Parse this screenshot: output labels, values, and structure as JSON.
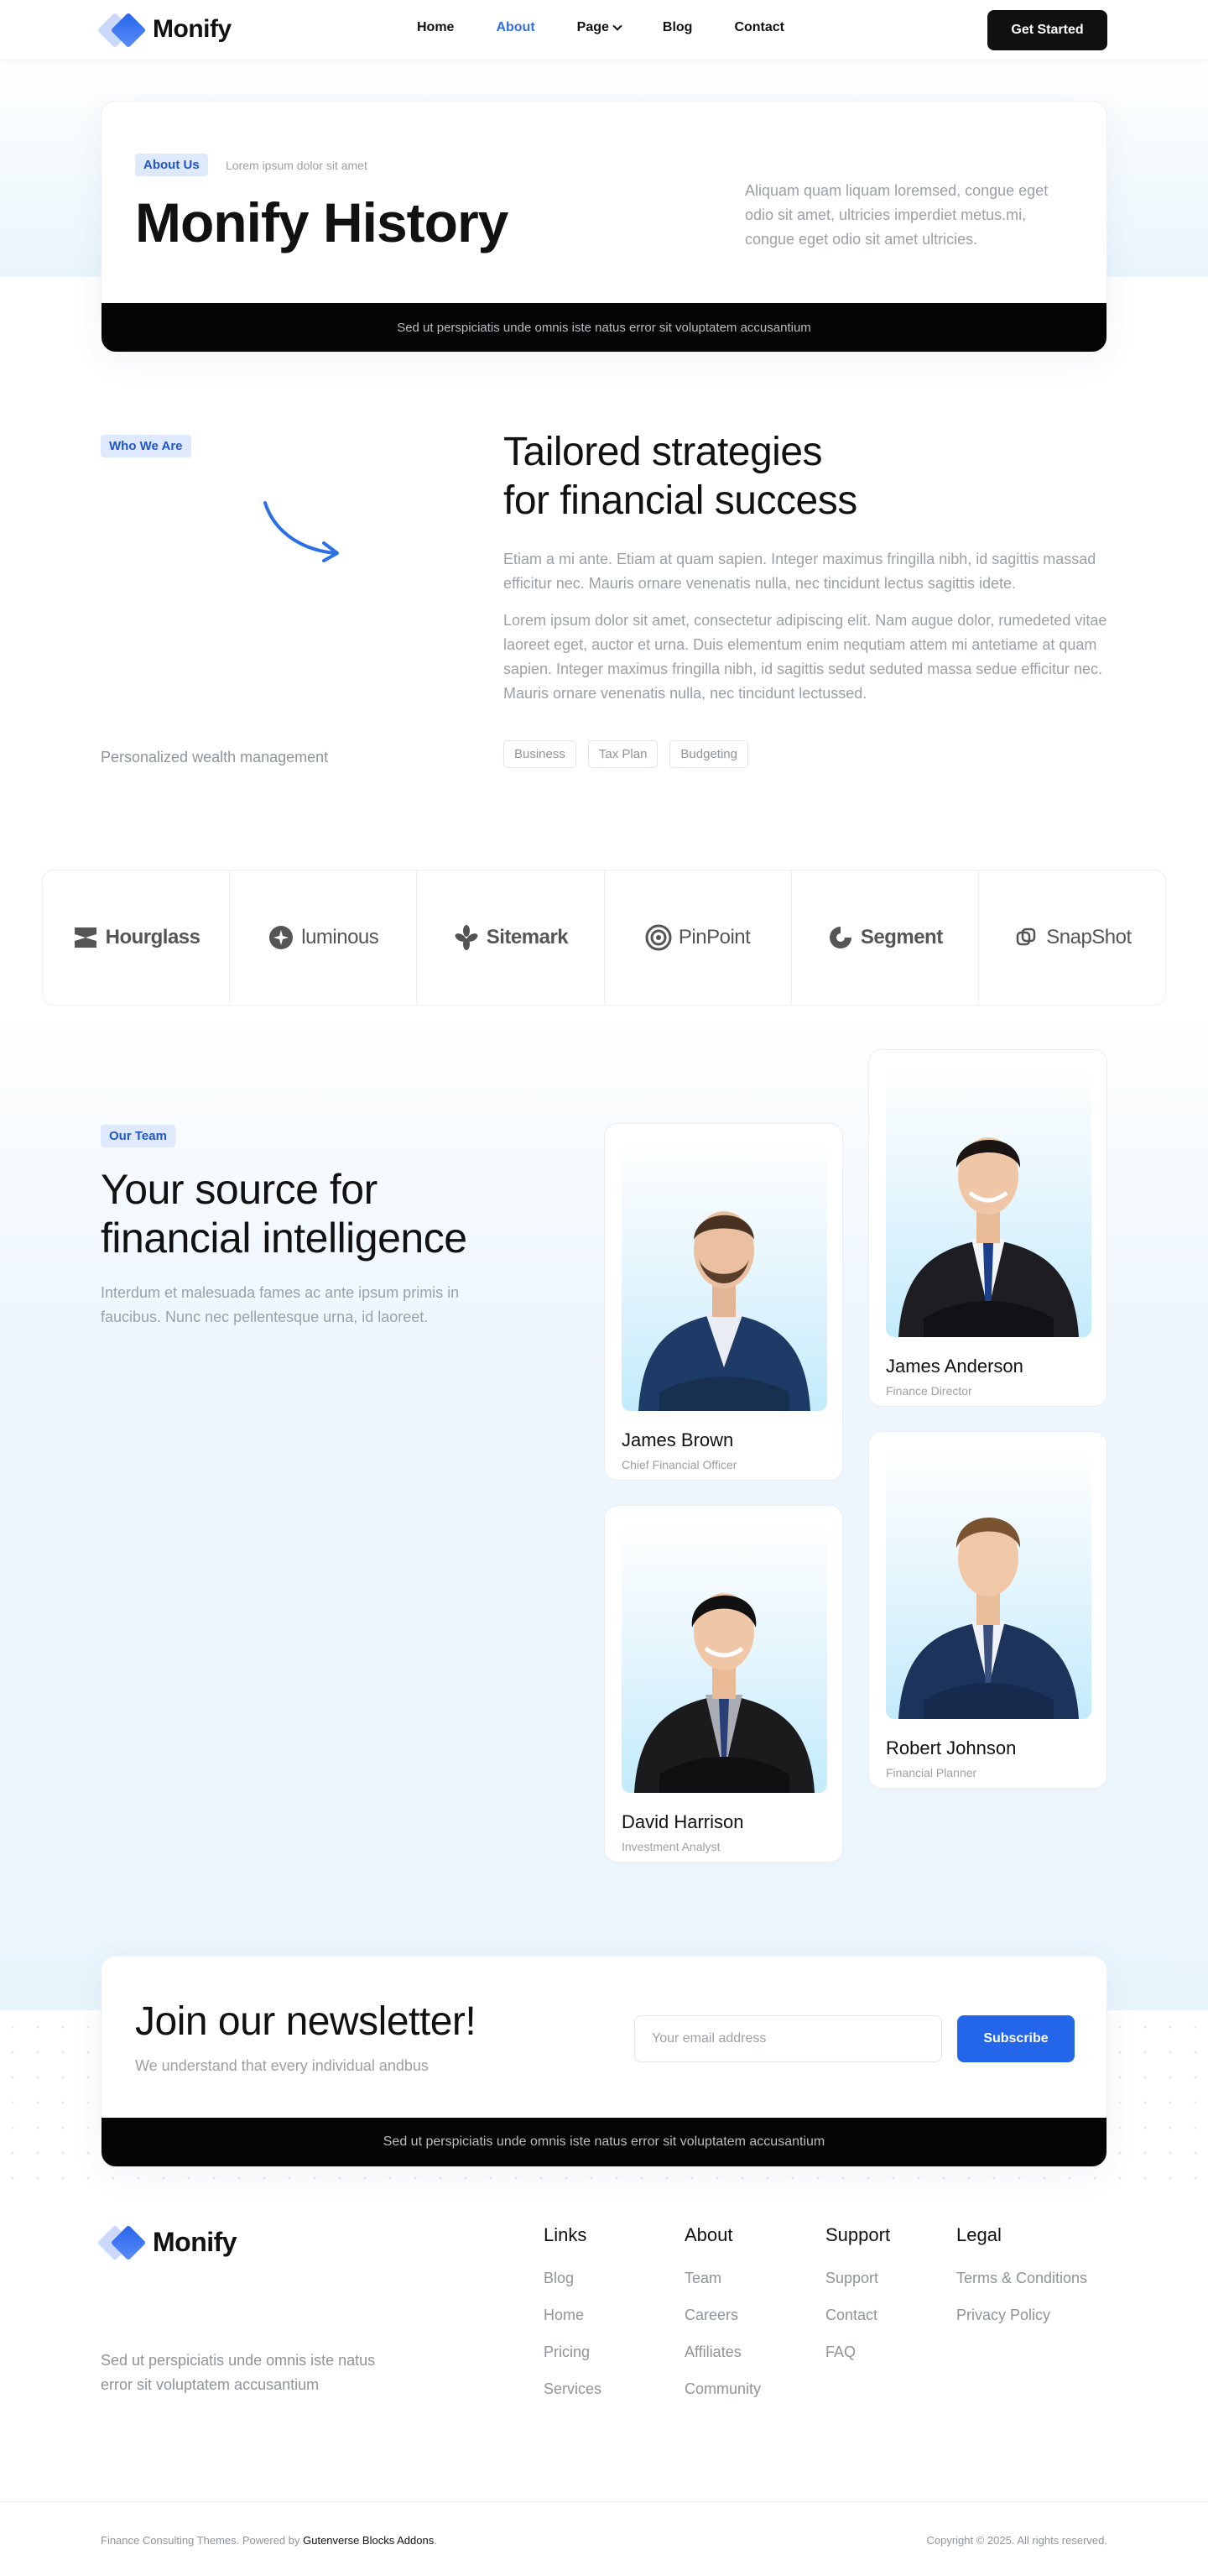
{
  "brand": {
    "name": "Monify"
  },
  "nav": {
    "items": [
      {
        "label": "Home",
        "active": false
      },
      {
        "label": "About",
        "active": true
      },
      {
        "label": "Page",
        "active": false,
        "dropdown": true
      },
      {
        "label": "Blog",
        "active": false
      },
      {
        "label": "Contact",
        "active": false
      }
    ],
    "cta": "Get Started"
  },
  "hero": {
    "badge": "About Us",
    "subtitle": "Lorem ipsum dolor sit amet",
    "title": "Monify History",
    "description": "Aliquam quam liquam loremsed, congue eget odio sit amet, ultricies imperdiet metus.mi, congue eget odio sit amet ultricies.",
    "strip": "Sed ut perspiciatis unde omnis iste natus error sit voluptatem accusantium"
  },
  "about": {
    "badge": "Who We Are",
    "caption": "Personalized wealth management",
    "title_line1": "Tailored strategies",
    "title_line2": "for financial success",
    "p1": "Etiam a mi ante. Etiam at quam sapien. Integer maximus fringilla nibh, id sagittis massad efficitur nec. Mauris ornare venenatis nulla, nec tincidunt lectus sagittis idete.",
    "p2": "Lorem ipsum dolor sit amet, consectetur adipiscing elit. Nam augue dolor, rumedeted vitae laoreet eget, auctor et urna. Duis elementum enim nequtiam attem mi antetiame at quam sapien. Integer maximus fringilla nibh, id sagittis sedut seduted massa sedue efficitur nec. Mauris ornare venenatis nulla, nec tincidunt lectussed.",
    "tags": [
      "Business",
      "Tax Plan",
      "Budgeting"
    ]
  },
  "partners": [
    {
      "name": "Hourglass",
      "icon": "hourglass-icon"
    },
    {
      "name": "luminous",
      "icon": "luminous-icon"
    },
    {
      "name": "Sitemark",
      "icon": "sitemark-icon"
    },
    {
      "name": "PinPoint",
      "icon": "pinpoint-icon"
    },
    {
      "name": "Segment",
      "icon": "segment-icon"
    },
    {
      "name": "SnapShot",
      "icon": "snapshot-icon"
    }
  ],
  "team": {
    "badge": "Our Team",
    "title_line1": "Your source for",
    "title_line2": "financial intelligence",
    "description": "Interdum et malesuada fames ac ante ipsum primis in faucibus. Nunc nec pellentesque urna, id laoreet.",
    "members": [
      {
        "name": "James Brown",
        "role": "Chief Financial Officer"
      },
      {
        "name": "James Anderson",
        "role": "Finance Director"
      },
      {
        "name": "David Harrison",
        "role": "Investment Analyst"
      },
      {
        "name": "Robert Johnson",
        "role": "Financial Planner"
      }
    ]
  },
  "newsletter": {
    "title": "Join our newsletter!",
    "subtitle": "We understand that every individual andbus",
    "placeholder": "Your email address",
    "button": "Subscribe",
    "strip": "Sed ut perspiciatis unde omnis iste natus error sit voluptatem accusantium"
  },
  "footer": {
    "description": "Sed ut perspiciatis unde omnis iste natus error sit voluptatem accusantium",
    "columns": [
      {
        "title": "Links",
        "items": [
          "Blog",
          "Home",
          "Pricing",
          "Services"
        ]
      },
      {
        "title": "About",
        "items": [
          "Team",
          "Careers",
          "Affiliates",
          "Community"
        ]
      },
      {
        "title": "Support",
        "items": [
          "Support",
          "Contact",
          "FAQ"
        ]
      },
      {
        "title": "Legal",
        "items": [
          "Terms & Conditions",
          "Privacy Policy"
        ]
      }
    ],
    "credit_prefix": "Finance Consulting Themes. Powered by ",
    "credit_link": "Gutenverse Blocks Addons",
    "credit_suffix": ".",
    "copyright": "Copyright © 2025. All rights reserved."
  },
  "colors": {
    "accent": "#2466ea",
    "dark": "#050505",
    "badge_bg": "#dfe9fd"
  }
}
